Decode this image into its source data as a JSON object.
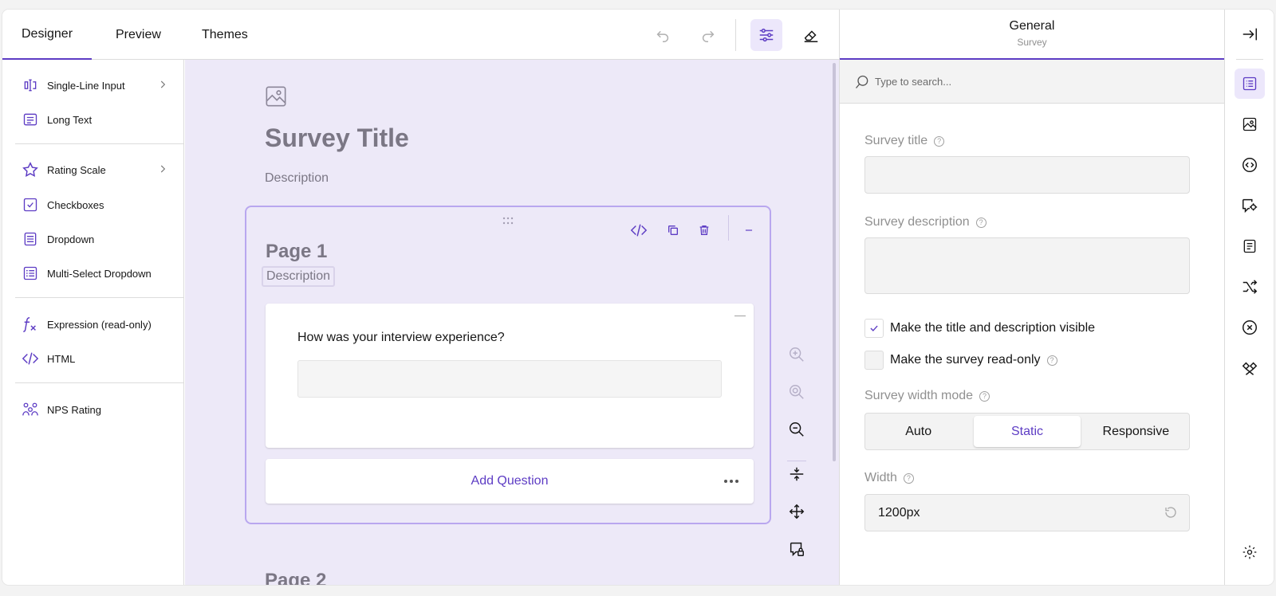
{
  "header": {
    "tabs": [
      {
        "label": "Designer",
        "active": true
      },
      {
        "label": "Preview",
        "active": false
      },
      {
        "label": "Themes",
        "active": false
      }
    ],
    "tools": [
      "undo-icon",
      "redo-icon",
      "settings-sliders-icon",
      "eraser-icon"
    ]
  },
  "toolbox": {
    "items": [
      {
        "label": "Single-Line Input",
        "icon": "text-cursor-icon",
        "has_submenu": true
      },
      {
        "label": "Long Text",
        "icon": "long-text-icon",
        "has_submenu": false
      },
      {
        "label": "Rating Scale",
        "icon": "star-icon",
        "has_submenu": true
      },
      {
        "label": "Checkboxes",
        "icon": "checkbox-icon",
        "has_submenu": false
      },
      {
        "label": "Dropdown",
        "icon": "dropdown-icon",
        "has_submenu": false
      },
      {
        "label": "Multi-Select Dropdown",
        "icon": "multi-select-icon",
        "has_submenu": false
      },
      {
        "label": "Expression (read-only)",
        "icon": "function-icon",
        "has_submenu": false
      },
      {
        "label": "HTML",
        "icon": "code-icon",
        "has_submenu": false
      },
      {
        "label": "NPS Rating",
        "icon": "nps-icon",
        "has_submenu": false
      }
    ]
  },
  "canvas": {
    "survey_title": "Survey Title",
    "survey_description": "Description",
    "page": {
      "title": "Page 1",
      "description": "Description",
      "question": {
        "title": "How was your interview experience?",
        "value": ""
      },
      "add_question_label": "Add Question"
    },
    "next_page_title": "Page 2"
  },
  "properties": {
    "header_title": "General",
    "header_subtitle": "Survey",
    "search_placeholder": "Type to search...",
    "survey_title_label": "Survey title",
    "survey_title_value": "",
    "survey_description_label": "Survey description",
    "survey_description_value": "",
    "show_title_label": "Make the title and description visible",
    "show_title_checked": true,
    "read_only_label": "Make the survey read-only",
    "read_only_checked": false,
    "width_mode_label": "Survey width mode",
    "width_mode_options": [
      "Auto",
      "Static",
      "Responsive"
    ],
    "width_mode_selected": "Static",
    "width_label": "Width",
    "width_value": "1200px"
  },
  "colors": {
    "accent": "#5d3cc4",
    "canvas_bg": "#ede9f8",
    "page_border": "#b9a7ef"
  }
}
